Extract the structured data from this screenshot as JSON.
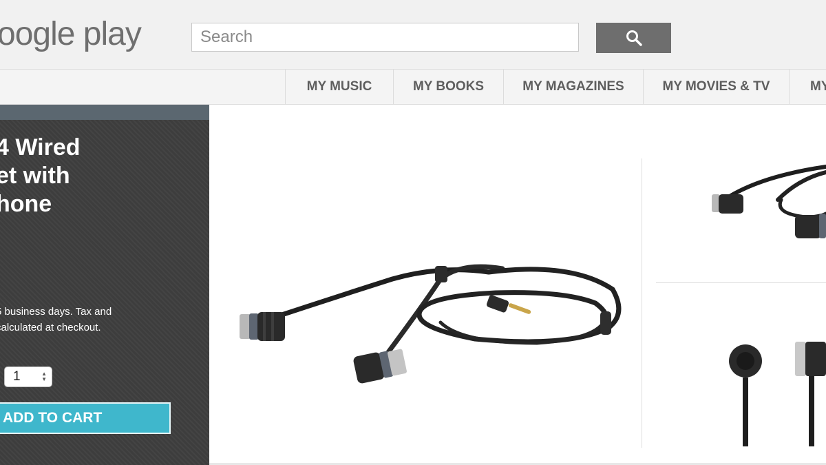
{
  "header": {
    "logo_text": "oogle play",
    "search": {
      "placeholder": "Search",
      "value": ""
    },
    "search_button_icon": "search-icon"
  },
  "nav": {
    "items": [
      {
        "label": "MY MUSIC"
      },
      {
        "label": "MY BOOKS"
      },
      {
        "label": "MY MAGAZINES"
      },
      {
        "label": "MY MOVIES & TV"
      },
      {
        "label": "MY"
      }
    ]
  },
  "product": {
    "title_lines": [
      "4 Wired",
      "et with",
      "hone"
    ],
    "shipping_lines": [
      "5 business days. Tax and",
      "calculated at checkout."
    ],
    "quantity": "1",
    "add_to_cart_label": "ADD TO CART"
  },
  "colors": {
    "panel_background": "#3d3d3d",
    "panel_stripe": "#5b6770",
    "add_to_cart": "#3fb7cc",
    "search_button": "#6e6e6e"
  }
}
